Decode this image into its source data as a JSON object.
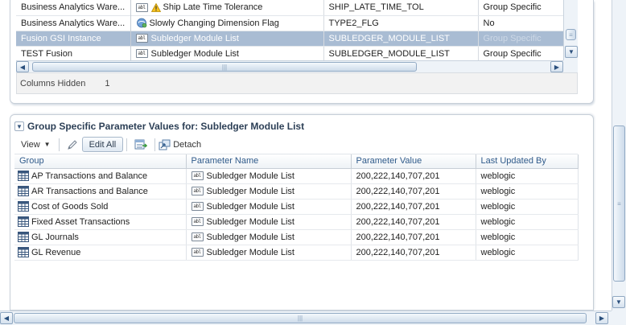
{
  "top_table": {
    "rows": [
      {
        "source": "Business Analytics Ware...",
        "name": "Ship Late Time Tolerance",
        "code": "SHIP_LATE_TIME_TOL",
        "value": "Group Specific",
        "warn": true
      },
      {
        "source": "Business Analytics Ware...",
        "name": "Slowly Changing Dimension Flag",
        "code": "TYPE2_FLG",
        "value": "No"
      },
      {
        "source": "Fusion GSI Instance",
        "name": "Subledger Module List",
        "code": "SUBLEDGER_MODULE_LIST",
        "value": "Group Specific",
        "selected": true
      },
      {
        "source": "TEST Fusion",
        "name": "Subledger Module List",
        "code": "SUBLEDGER_MODULE_LIST",
        "value": "Group Specific"
      }
    ],
    "columns_hidden_label": "Columns Hidden",
    "columns_hidden_count": "1"
  },
  "group_panel": {
    "title": "Group Specific Parameter Values for: Subledger Module List",
    "toolbar": {
      "view_label": "View",
      "edit_all_label": "Edit All",
      "detach_label": "Detach"
    },
    "columns": [
      "Group",
      "Parameter Name",
      "Parameter Value",
      "Last Updated By"
    ],
    "rows": [
      {
        "group": "AP Transactions and Balance",
        "param": "Subledger Module List",
        "value": "200,222,140,707,201",
        "updated_by": "weblogic"
      },
      {
        "group": "AR Transactions and Balance",
        "param": "Subledger Module List",
        "value": "200,222,140,707,201",
        "updated_by": "weblogic"
      },
      {
        "group": "Cost of Goods Sold",
        "param": "Subledger Module List",
        "value": "200,222,140,707,201",
        "updated_by": "weblogic"
      },
      {
        "group": "Fixed Asset Transactions",
        "param": "Subledger Module List",
        "value": "200,222,140,707,201",
        "updated_by": "weblogic"
      },
      {
        "group": "GL Journals",
        "param": "Subledger Module List",
        "value": "200,222,140,707,201",
        "updated_by": "weblogic"
      },
      {
        "group": "GL Revenue",
        "param": "Subledger Module List",
        "value": "200,222,140,707,201",
        "updated_by": "weblogic"
      }
    ]
  },
  "icons": {
    "text_type": "abl",
    "warning": "warning-icon",
    "dimension": "dimension-icon",
    "group": "group-grid-icon"
  },
  "colors": {
    "selected_row": "#a9bcd3",
    "header_text": "#2f5a8a",
    "muted_value": "#9aa5b1"
  }
}
